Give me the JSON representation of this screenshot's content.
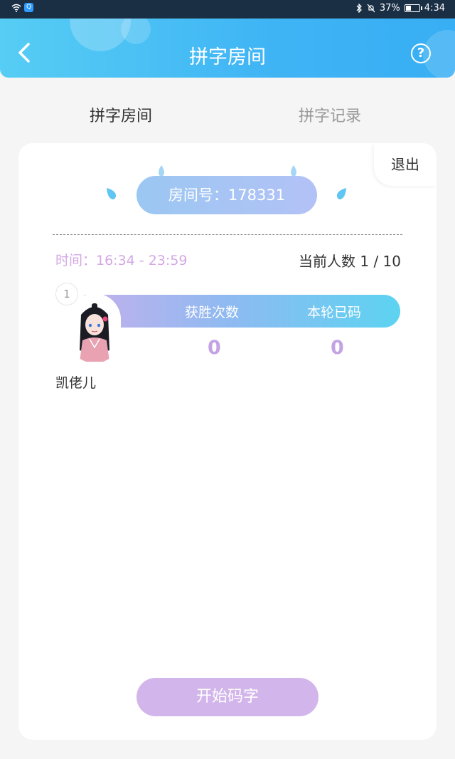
{
  "status_bar": {
    "battery_percent": "37%",
    "time": "4:34",
    "icons": [
      "wifi-icon",
      "app-notification-icon",
      "bluetooth-icon",
      "mute-icon",
      "battery-icon"
    ]
  },
  "header": {
    "title": "拼字房间",
    "back_icon": "chevron-left-icon",
    "help_label": "?"
  },
  "tabs": [
    {
      "label": "拼字房间",
      "active": true
    },
    {
      "label": "拼字记录",
      "active": false
    }
  ],
  "room": {
    "exit_label": "退出",
    "room_number_label": "房间号：178331",
    "time_label": "时间：16:34 - 23:59",
    "player_count_label": "当前人数 1 / 10"
  },
  "player_table": {
    "headers": [
      "获胜次数",
      "本轮已码"
    ],
    "players": [
      {
        "rank": "1",
        "name": "凯佬儿",
        "wins": "0",
        "typed": "0"
      }
    ]
  },
  "actions": {
    "start_label": "开始码字"
  },
  "colors": {
    "header_gradient_start": "#56cdf4",
    "header_gradient_end": "#38aef4",
    "accent_purple": "#d3a8e6",
    "start_button": "#d2b5ea"
  }
}
